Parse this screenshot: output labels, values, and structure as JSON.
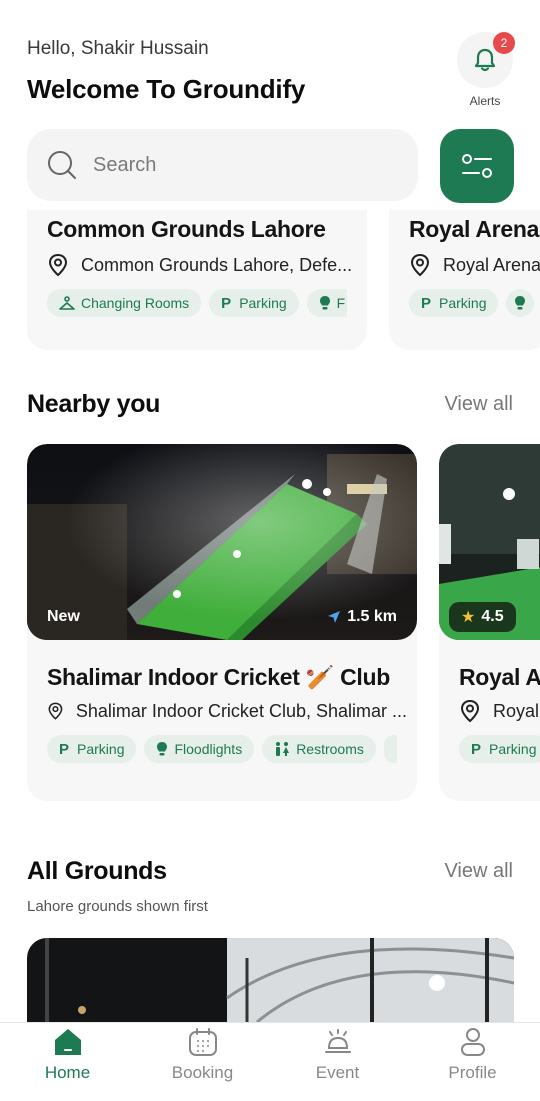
{
  "header": {
    "greeting": "Hello, Shakir Hussain",
    "welcome": "Welcome To Groundify",
    "alerts_label": "Alerts",
    "alerts_count": "2"
  },
  "search": {
    "placeholder": "Search"
  },
  "featured": [
    {
      "name": "Common Grounds Lahore",
      "location": "Common Grounds Lahore, Defe...",
      "amenities": [
        "Changing Rooms",
        "Parking",
        "F"
      ]
    },
    {
      "name": "Royal Arena",
      "location": "Royal Arena",
      "amenities": [
        "Parking"
      ]
    }
  ],
  "nearby": {
    "title": "Nearby you",
    "view_all": "View all",
    "cards": [
      {
        "badge": "New",
        "distance": "1.5 km",
        "name": "Shalimar Indoor  Cricket 🏏 Club",
        "location": "Shalimar Indoor Cricket Club, Shalimar ...",
        "amenities": [
          "Parking",
          "Floodlights",
          "Restrooms"
        ]
      },
      {
        "rating": "4.5",
        "name": "Royal Ar",
        "location": "Royal",
        "amenities": [
          "Parking"
        ]
      }
    ]
  },
  "all_grounds": {
    "title": "All Grounds",
    "view_all": "View all",
    "subtitle": "Lahore grounds shown first"
  },
  "nav": {
    "items": [
      {
        "label": "Home",
        "icon": "home-icon",
        "active": true
      },
      {
        "label": "Booking",
        "icon": "calendar-icon",
        "active": false
      },
      {
        "label": "Event",
        "icon": "bell-service-icon",
        "active": false
      },
      {
        "label": "Profile",
        "icon": "user-icon",
        "active": false
      }
    ]
  },
  "colors": {
    "brand": "#1e7a52",
    "badge": "#e74a4a",
    "card_bg": "#f6f7f6",
    "chip_bg": "#e6efe9"
  }
}
